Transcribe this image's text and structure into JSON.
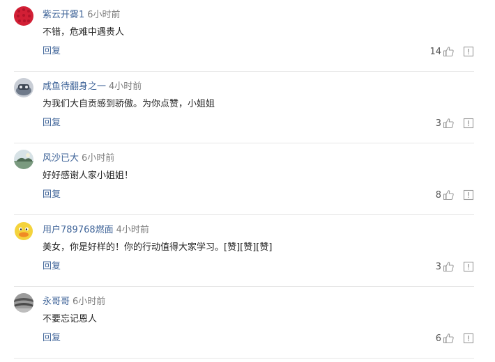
{
  "comments": [
    {
      "username": "紫云开雾1",
      "time": "6小时前",
      "content": "不错，危难中遇贵人",
      "reply": "回复",
      "likes": "14",
      "avatar_color": "#d21f35"
    },
    {
      "username": "咸鱼待翻身之一",
      "time": "4小时前",
      "content": "为我们大自贡感到骄傲。为你点赞，小姐姐",
      "reply": "回复",
      "likes": "3",
      "avatar_color": "#8d98a8"
    },
    {
      "username": "风沙已大",
      "time": "6小时前",
      "content": "好好感谢人家小姐姐！",
      "reply": "回复",
      "likes": "8",
      "avatar_color": "#9fb09a"
    },
    {
      "username": "用户789768燃面",
      "time": "4小时前",
      "content": "美女，你是好样的！你的行动值得大家学习。[赞][赞][赞]",
      "reply": "回复",
      "likes": "3",
      "avatar_color": "#f1d23b"
    },
    {
      "username": "永哥哥",
      "time": "6小时前",
      "content": "不要忘记恩人",
      "reply": "回复",
      "likes": "6",
      "avatar_color": "#6b6b6b"
    }
  ],
  "icons": {
    "like": "thumbs-up-icon",
    "report": "report-icon"
  },
  "colors": {
    "username": "#406599",
    "time": "#7d7d7d",
    "reply": "#406599",
    "divider": "#e6e6e6"
  }
}
